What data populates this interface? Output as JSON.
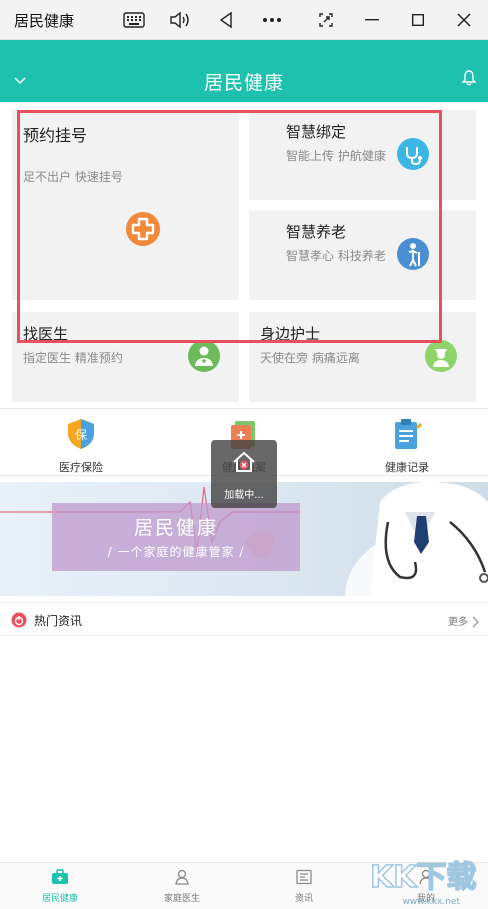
{
  "window": {
    "title": "居民健康"
  },
  "header": {
    "title": "居民健康"
  },
  "services": [
    {
      "title": "预约挂号",
      "subtitle": "足不出户 快速挂号",
      "icon": "hospital-cross-icon",
      "color": "#f08a3a"
    },
    {
      "title": "智慧绑定",
      "subtitle": "智能上传 护航健康",
      "icon": "stethoscope-icon",
      "color": "#3db6e6"
    },
    {
      "title": "智慧养老",
      "subtitle": "智慧孝心 科技养老",
      "icon": "elderly-icon",
      "color": "#4a8fd4"
    },
    {
      "title": "找医生",
      "subtitle": "指定医生 精准预约",
      "icon": "doctor-icon",
      "color": "#6cbb5a"
    },
    {
      "title": "身边护士",
      "subtitle": "天使在旁 病痛远离",
      "icon": "nurse-icon",
      "color": "#8fd46a"
    }
  ],
  "shortcuts": [
    {
      "label": "医疗保险",
      "icon": "insurance-shield-icon"
    },
    {
      "label": "健康档案",
      "icon": "health-archive-icon"
    },
    {
      "label": "健康记录",
      "icon": "health-record-icon"
    }
  ],
  "toast": {
    "text": "加载中..."
  },
  "banner": {
    "title": "居民健康",
    "subtitle": "/ 一个家庭的健康管家 /"
  },
  "news": {
    "title": "热门资讯",
    "more": "更多"
  },
  "bottom_nav": [
    {
      "label": "居民健康",
      "icon": "medkit-icon",
      "active": true
    },
    {
      "label": "家庭医生",
      "icon": "family-doctor-icon",
      "active": false
    },
    {
      "label": "资讯",
      "icon": "news-icon",
      "active": false
    },
    {
      "label": "我的",
      "icon": "profile-icon",
      "active": false
    }
  ],
  "watermark": {
    "text": "KK下载",
    "url": "www.kkx.net"
  },
  "colors": {
    "accent": "#1ec1ad",
    "highlight_border": "#e8505b",
    "card_bg": "#f2f2f2"
  }
}
